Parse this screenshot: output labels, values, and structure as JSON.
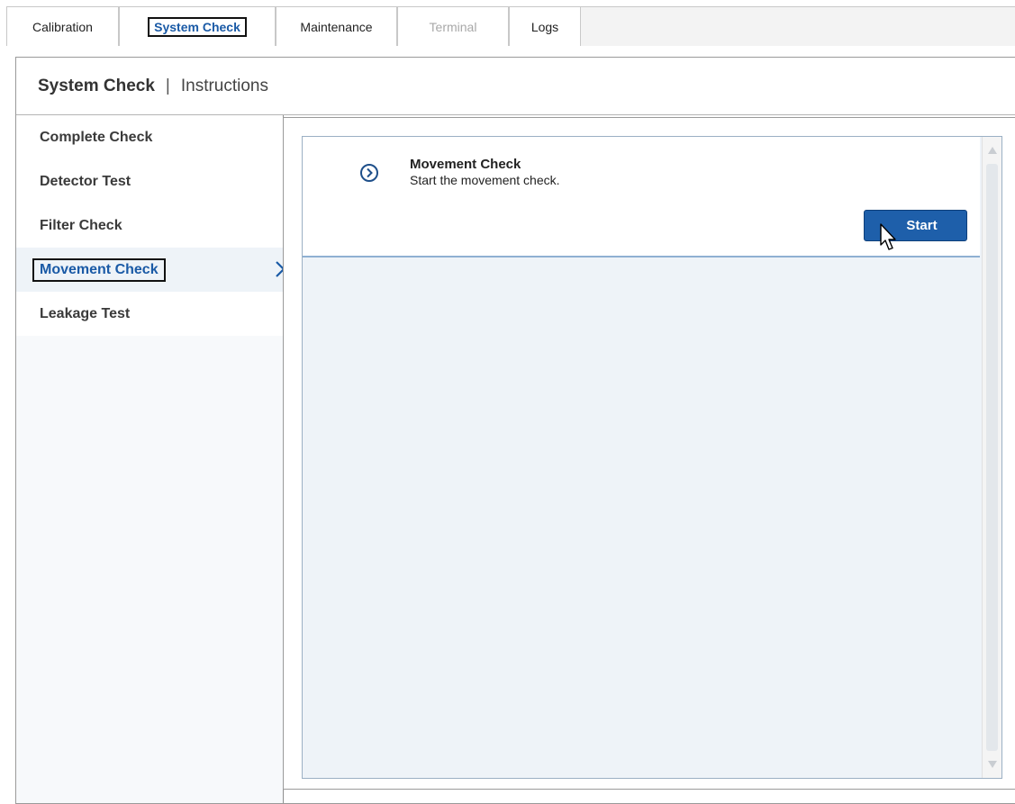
{
  "tabs": [
    {
      "label": "Calibration",
      "state": "normal"
    },
    {
      "label": "System Check",
      "state": "active"
    },
    {
      "label": "Maintenance",
      "state": "normal"
    },
    {
      "label": "Terminal",
      "state": "disabled"
    },
    {
      "label": "Logs",
      "state": "normal"
    }
  ],
  "header": {
    "title": "System Check",
    "separator": "|",
    "subtitle": "Instructions"
  },
  "sidebar": {
    "items": [
      {
        "label": "Complete Check"
      },
      {
        "label": "Detector Test"
      },
      {
        "label": "Filter Check"
      },
      {
        "label": "Movement Check",
        "selected": true
      },
      {
        "label": "Leakage Test"
      }
    ]
  },
  "card": {
    "icon": "chevron-right-circle-icon",
    "title": "Movement Check",
    "description": "Start the movement check.",
    "button_label": "Start"
  },
  "colors": {
    "accent": "#1e5faa",
    "active_text": "#1a5aa6",
    "content_bg": "#eef3f8"
  }
}
